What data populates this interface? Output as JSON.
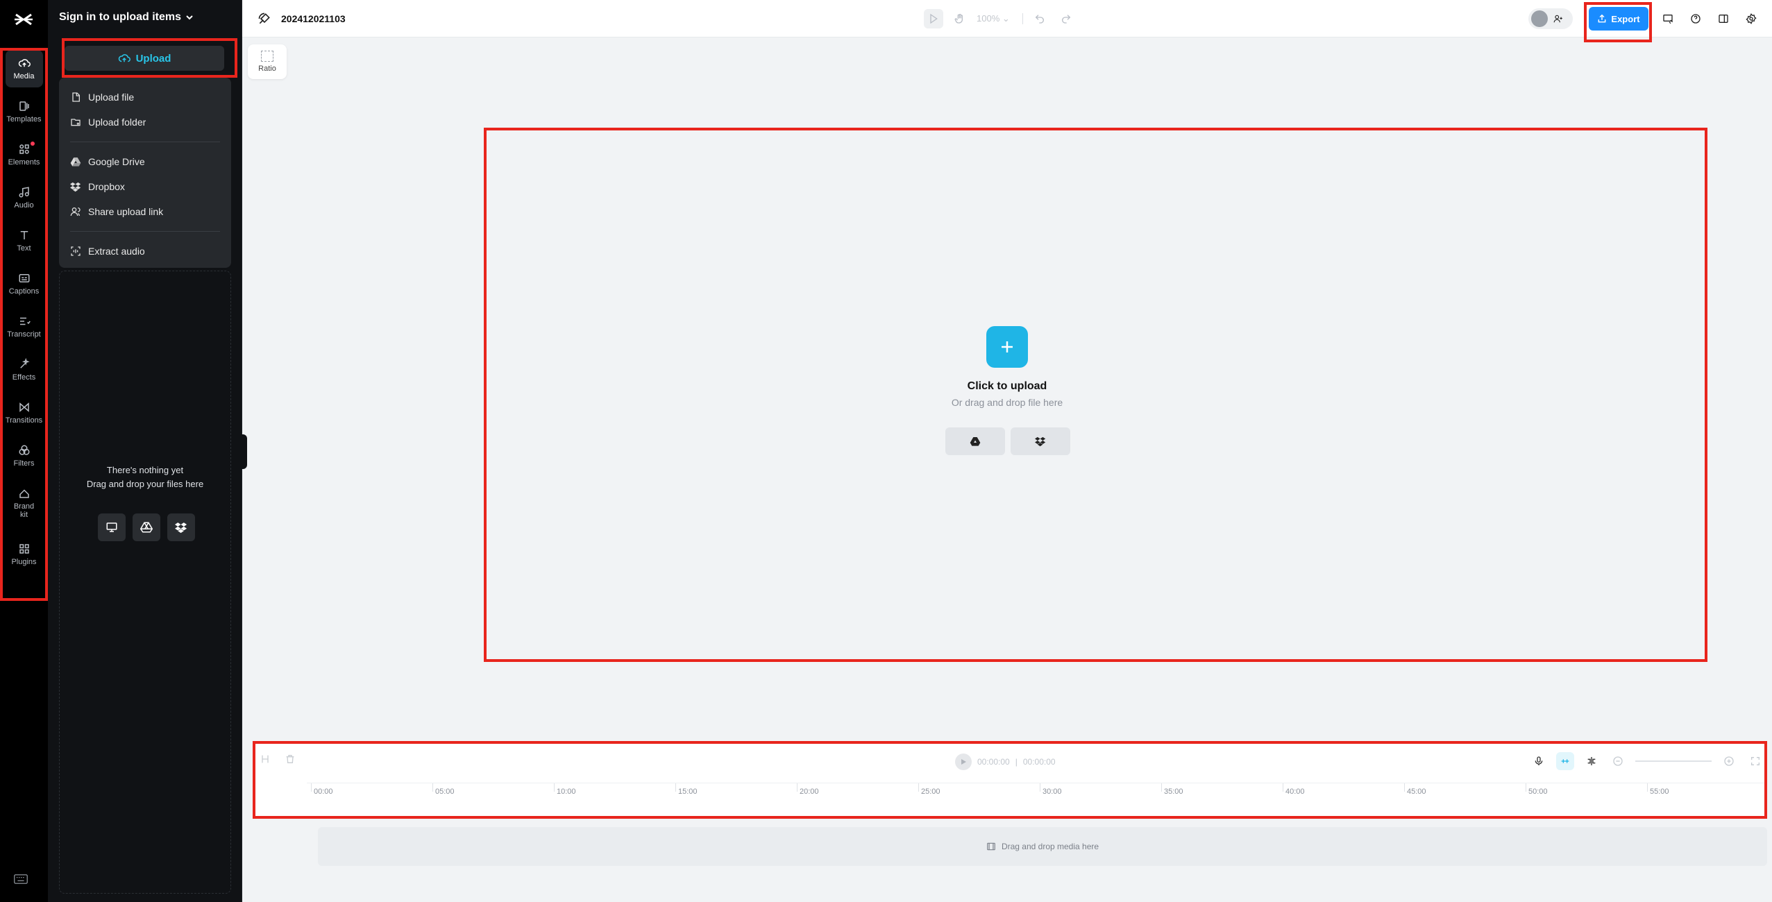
{
  "colors": {
    "accent": "#1fb5e6",
    "export": "#1a8cff",
    "highlight": "#e8251d"
  },
  "rail": {
    "items": [
      {
        "label": "Media",
        "icon": "cloud-upload-icon",
        "active": true
      },
      {
        "label": "Templates",
        "icon": "templates-icon"
      },
      {
        "label": "Elements",
        "icon": "elements-icon"
      },
      {
        "label": "Audio",
        "icon": "music-note-icon"
      },
      {
        "label": "Text",
        "icon": "text-icon"
      },
      {
        "label": "Captions",
        "icon": "captions-icon"
      },
      {
        "label": "Transcript",
        "icon": "transcript-icon"
      },
      {
        "label": "Effects",
        "icon": "effects-icon"
      },
      {
        "label": "Transitions",
        "icon": "transitions-icon"
      },
      {
        "label": "Filters",
        "icon": "filters-icon"
      },
      {
        "label": "Brand kit",
        "icon": "brand-kit-icon"
      },
      {
        "label": "Plugins",
        "icon": "plugins-icon"
      }
    ]
  },
  "panel": {
    "title": "Sign in to upload items",
    "upload_label": "Upload",
    "menu": {
      "upload_file": "Upload file",
      "upload_folder": "Upload folder",
      "google_drive": "Google Drive",
      "dropbox": "Dropbox",
      "share_link": "Share upload link",
      "extract_audio": "Extract audio"
    },
    "empty_line1": "There's nothing yet",
    "empty_line2": "Drag and drop your files here"
  },
  "topbar": {
    "project_name": "202412021103",
    "zoom": "100%",
    "export_label": "Export"
  },
  "ratio_label": "Ratio",
  "canvas": {
    "click_to_upload": "Click to upload",
    "or_drag": "Or drag and drop file here"
  },
  "timeline": {
    "current_time": "00:00:00",
    "total_time": "00:00:00",
    "ticks": [
      "00:00",
      "05:00",
      "10:00",
      "15:00",
      "20:00",
      "25:00",
      "30:00",
      "35:00",
      "40:00",
      "45:00",
      "50:00",
      "55:00"
    ],
    "dropzone": "Drag and drop media here"
  }
}
